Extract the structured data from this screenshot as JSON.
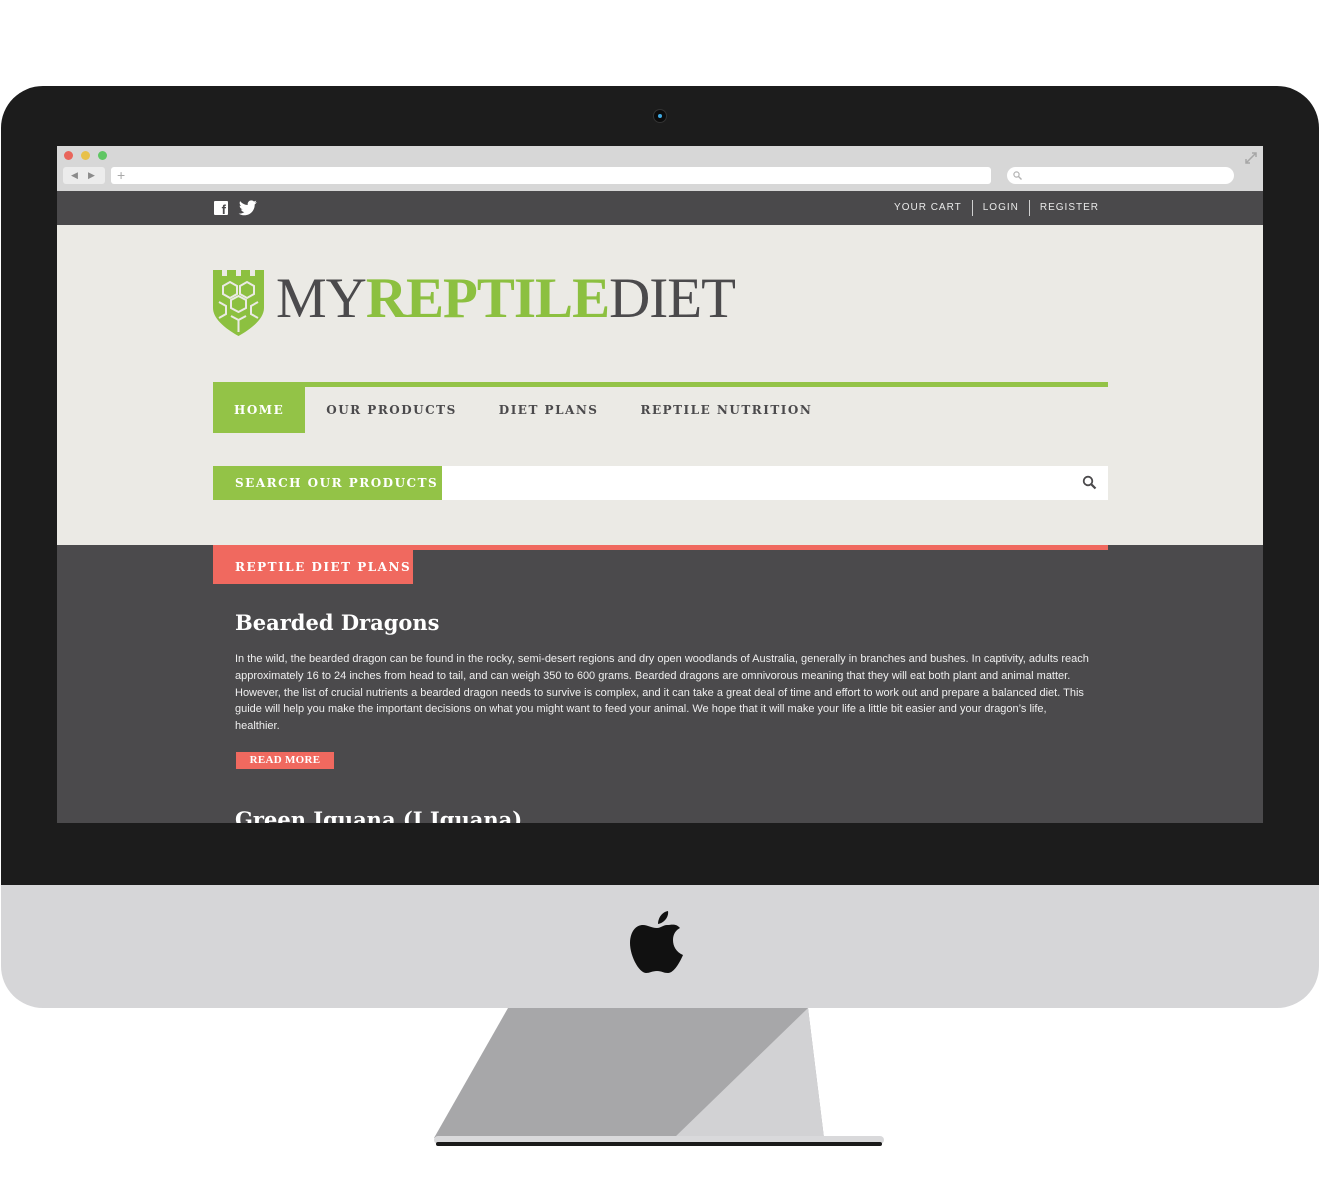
{
  "colors": {
    "brand_green": "#93c347",
    "accent_coral": "#f0695f",
    "dark_gray": "#4b4a4c",
    "header_bg": "#ebeae5"
  },
  "topbar": {
    "social_icons": [
      "facebook-icon",
      "twitter-icon"
    ],
    "links": [
      "YOUR CART",
      "LOGIN",
      "REGISTER"
    ]
  },
  "logo": {
    "part1": "MY",
    "part2": "REPTILE",
    "part3": "DIET"
  },
  "nav": {
    "items": [
      "HOME",
      "OUR PRODUCTS",
      "DIET PLANS",
      "REPTILE NUTRITION"
    ],
    "active": "HOME"
  },
  "search": {
    "label": "SEARCH OUR PRODUCTS",
    "value": ""
  },
  "section": {
    "title": "REPTILE DIET PLANS"
  },
  "articles": [
    {
      "title": "Bearded Dragons",
      "body": "In the wild, the bearded dragon can be found in the rocky, semi-desert regions and dry open woodlands of Australia, generally in branches and bushes. In captivity, adults reach approximately 16 to 24 inches from head to tail, and can weigh 350 to 600 grams. Bearded dragons are omnivorous meaning that they will eat both plant and animal matter. However, the list of crucial nutrients a bearded dragon needs to survive is complex, and it can take a great deal of time and effort to work out and prepare a balanced diet. This guide will help you make the important decisions on what you might want to feed your animal. We hope that it will make your life a little bit easier and your dragon’s life, healthier.",
      "button": "READ MORE"
    },
    {
      "title": "Green Iguana (I.Iguana)"
    }
  ]
}
